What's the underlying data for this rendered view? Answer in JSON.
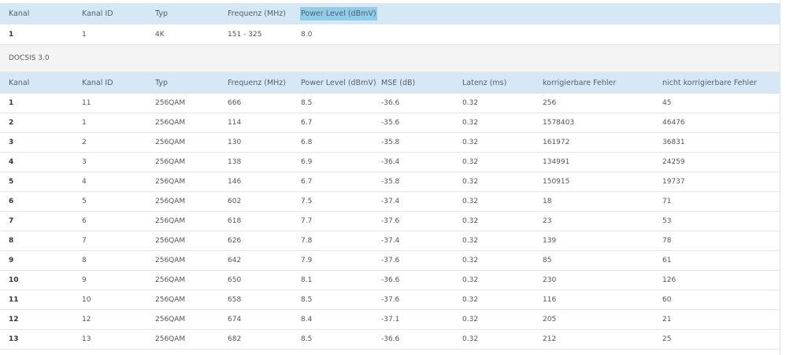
{
  "table1": {
    "headers": [
      "Kanal",
      "Kanal ID",
      "Typ",
      "Frequenz (MHz)",
      "Power Level (dBmV)"
    ],
    "rows": [
      [
        "1",
        "1",
        "4K",
        "151 - 325",
        "8.0"
      ]
    ]
  },
  "section_label": "DOCSIS 3.0",
  "table2": {
    "headers": [
      "Kanal",
      "Kanal ID",
      "Typ",
      "Frequenz (MHz)",
      "Power Level (dBmV)",
      "MSE (dB)",
      "Latenz (ms)",
      "korrigierbare Fehler",
      "nicht korrigierbare Fehler"
    ],
    "rows": [
      [
        "1",
        "11",
        "256QAM",
        "666",
        "8.5",
        "-36.6",
        "0.32",
        "256",
        "45"
      ],
      [
        "2",
        "1",
        "256QAM",
        "114",
        "6.7",
        "-35.6",
        "0.32",
        "1578403",
        "46476"
      ],
      [
        "3",
        "2",
        "256QAM",
        "130",
        "6.8",
        "-35.8",
        "0.32",
        "161972",
        "36831"
      ],
      [
        "4",
        "3",
        "256QAM",
        "138",
        "6.9",
        "-36.4",
        "0.32",
        "134991",
        "24259"
      ],
      [
        "5",
        "4",
        "256QAM",
        "146",
        "6.7",
        "-35.8",
        "0.32",
        "150915",
        "19737"
      ],
      [
        "6",
        "5",
        "256QAM",
        "602",
        "7.5",
        "-37.4",
        "0.32",
        "18",
        "71"
      ],
      [
        "7",
        "6",
        "256QAM",
        "618",
        "7.7",
        "-37.6",
        "0.32",
        "23",
        "53"
      ],
      [
        "8",
        "7",
        "256QAM",
        "626",
        "7.8",
        "-37.4",
        "0.32",
        "139",
        "78"
      ],
      [
        "9",
        "8",
        "256QAM",
        "642",
        "7.9",
        "-37.6",
        "0.32",
        "85",
        "61"
      ],
      [
        "10",
        "9",
        "256QAM",
        "650",
        "8.1",
        "-36.6",
        "0.32",
        "230",
        "126"
      ],
      [
        "11",
        "10",
        "256QAM",
        "658",
        "8.5",
        "-37.6",
        "0.32",
        "116",
        "60"
      ],
      [
        "12",
        "12",
        "256QAM",
        "674",
        "8.4",
        "-37.1",
        "0.32",
        "205",
        "21"
      ],
      [
        "13",
        "13",
        "256QAM",
        "682",
        "8.5",
        "-36.6",
        "0.32",
        "212",
        "25"
      ]
    ]
  }
}
